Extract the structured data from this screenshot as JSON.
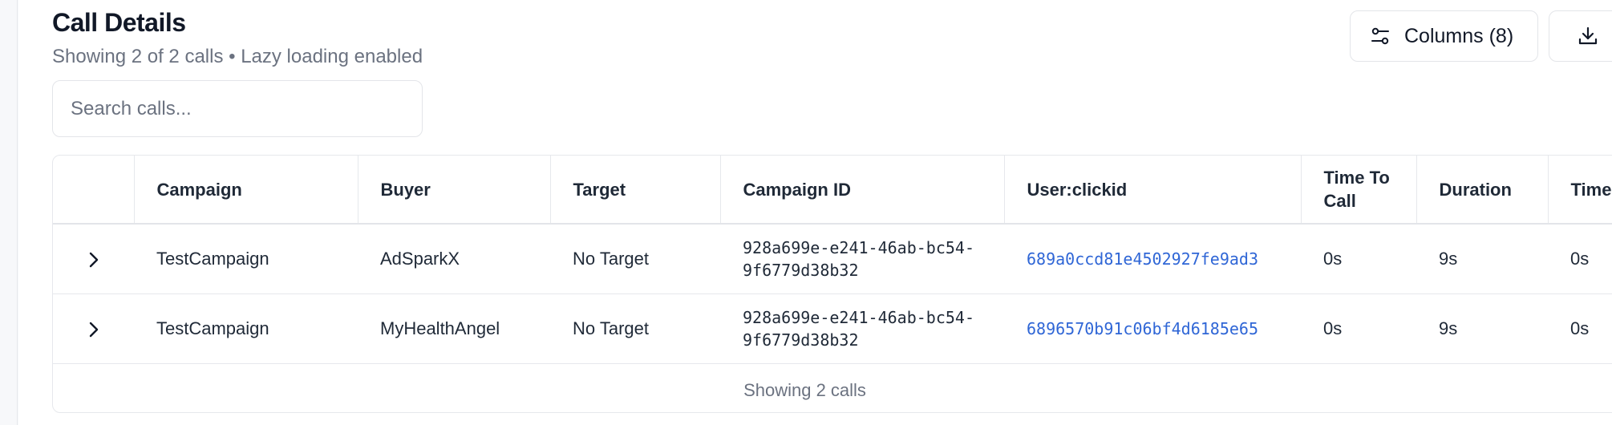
{
  "header": {
    "title": "Call Details",
    "subtitle": "Showing 2 of 2 calls • Lazy loading enabled"
  },
  "toolbar": {
    "columns_label": "Columns (8)",
    "columns_icon": "sliders-icon",
    "download_icon": "download-icon"
  },
  "search": {
    "placeholder": "Search calls...",
    "value": ""
  },
  "table": {
    "columns": [
      "",
      "Campaign",
      "Buyer",
      "Target",
      "Campaign ID",
      "User:clickid",
      "Time To Call",
      "Duration",
      "Time To Conn..."
    ],
    "rows": [
      {
        "campaign": "TestCampaign",
        "buyer": "AdSparkX",
        "target": "No Target",
        "campaign_id": "928a699e-e241-46ab-bc54-9f6779d38b32",
        "clickid": "689a0ccd81e4502927fe9ad3",
        "time_to_call": "0s",
        "duration": "9s",
        "time_to_connect": "0s"
      },
      {
        "campaign": "TestCampaign",
        "buyer": "MyHealthAngel",
        "target": "No Target",
        "campaign_id": "928a699e-e241-46ab-bc54-9f6779d38b32",
        "clickid": "6896570b91c06bf4d6185e65",
        "time_to_call": "0s",
        "duration": "9s",
        "time_to_connect": "0s"
      }
    ],
    "footer": "Showing 2 calls"
  },
  "colors": {
    "link": "#2f66d6",
    "muted_text": "#6b7280",
    "border": "#e6e8ec"
  }
}
